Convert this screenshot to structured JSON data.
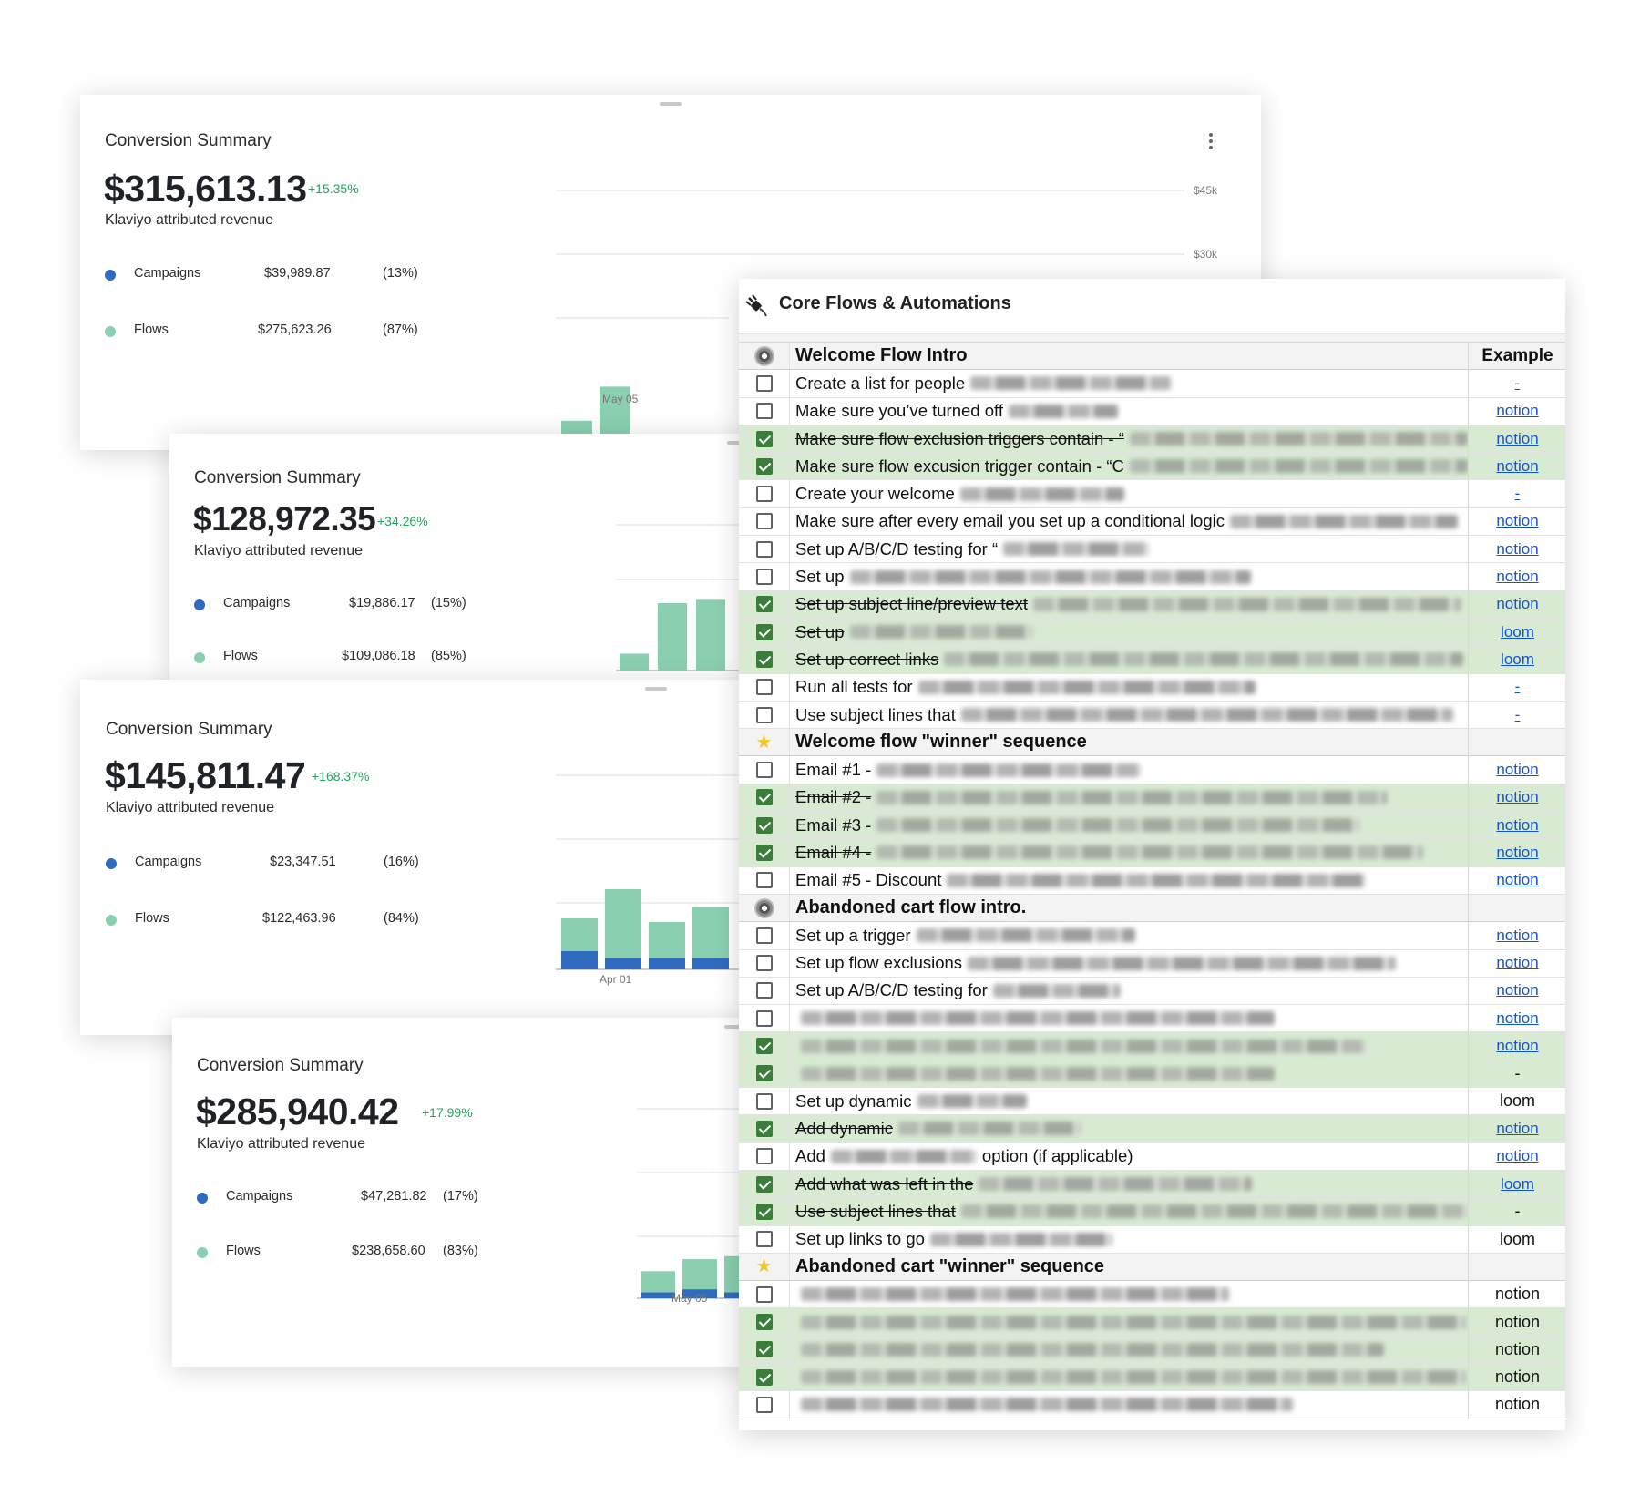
{
  "cards": [
    {
      "title": "Conversion Summary",
      "amount": "$315,613.13",
      "change": "+15.35%",
      "subtitle": "Klaviyo attributed revenue",
      "campaigns": {
        "label": "Campaigns",
        "value": "$39,989.87",
        "pct": "(13%)"
      },
      "flows": {
        "label": "Flows",
        "value": "$275,623.26",
        "pct": "(87%)"
      },
      "axis": {
        "top": "$45k",
        "mid": "$30k",
        "date": "May 05"
      }
    },
    {
      "title": "Conversion Summary",
      "amount": "$128,972.35",
      "change": "+34.26%",
      "subtitle": "Klaviyo attributed revenue",
      "campaigns": {
        "label": "Campaigns",
        "value": "$19,886.17",
        "pct": "(15%)"
      },
      "flows": {
        "label": "Flows",
        "value": "$109,086.18",
        "pct": "(85%)"
      }
    },
    {
      "title": "Conversion Summary",
      "amount": "$145,811.47",
      "change": "+168.37%",
      "subtitle": "Klaviyo attributed revenue",
      "campaigns": {
        "label": "Campaigns",
        "value": "$23,347.51",
        "pct": "(16%)"
      },
      "flows": {
        "label": "Flows",
        "value": "$122,463.96",
        "pct": "(84%)"
      },
      "axis": {
        "date": "Apr 01"
      }
    },
    {
      "title": "Conversion Summary",
      "amount": "$285,940.42",
      "change": "+17.99%",
      "subtitle": "Klaviyo attributed revenue",
      "campaigns": {
        "label": "Campaigns",
        "value": "$47,281.82",
        "pct": "(17%)"
      },
      "flows": {
        "label": "Flows",
        "value": "$238,658.60",
        "pct": "(83%)"
      },
      "axis": {
        "date": "May 05"
      }
    }
  ],
  "colors": {
    "campaigns": "#2f6bbf",
    "flows": "#8ad0b0",
    "done_row": "#d9ead3",
    "link": "#1155cc"
  },
  "chart_data": [
    {
      "type": "bar",
      "stacked": true,
      "series": [
        {
          "name": "Campaigns",
          "values": [
            2,
            4,
            0.5
          ]
        },
        {
          "name": "Flows",
          "values": [
            11,
            20,
            0.5
          ]
        }
      ]
    },
    {
      "type": "bar",
      "stacked": true,
      "series": [
        {
          "name": "Campaigns",
          "values": [
            0,
            0,
            0
          ]
        },
        {
          "name": "Flows",
          "values": [
            5,
            20,
            21
          ]
        }
      ]
    },
    {
      "type": "bar",
      "stacked": true,
      "series": [
        {
          "name": "Campaigns",
          "values": [
            5,
            3,
            3,
            3
          ]
        },
        {
          "name": "Flows",
          "values": [
            9,
            19,
            10,
            14
          ]
        }
      ]
    },
    {
      "type": "bar",
      "stacked": true,
      "series": [
        {
          "name": "Campaigns",
          "values": [
            2,
            3,
            2
          ]
        },
        {
          "name": "Flows",
          "values": [
            7,
            10,
            12
          ]
        }
      ]
    },
    {
      "type": "bar",
      "stacked": true,
      "series": [
        {
          "name": "Flows",
          "values": [
            5,
            15,
            28,
            17,
            28,
            29
          ]
        }
      ]
    }
  ],
  "sheet": {
    "title": "Core Flows & Automations",
    "rows": [
      {
        "kind": "section",
        "icon": "gear",
        "text": "Welcome Flow Intro",
        "ex": "Example"
      },
      {
        "kind": "item",
        "done": false,
        "text": "Create a list for people",
        "blur": 220,
        "ex": "-",
        "exStyle": "link"
      },
      {
        "kind": "item",
        "done": false,
        "text": "Make sure you’ve turned off",
        "blur": 120,
        "ex": "notion",
        "exStyle": "link"
      },
      {
        "kind": "item",
        "done": true,
        "text": "Make sure flow exclusion triggers contain - “",
        "blur": 380,
        "ex": "notion",
        "exStyle": "link"
      },
      {
        "kind": "item",
        "done": true,
        "text": "Make sure flow excusion trigger contain - “C",
        "blur": 390,
        "ex": "notion",
        "exStyle": "link"
      },
      {
        "kind": "item",
        "done": false,
        "text": "Create your welcome",
        "blur": 180,
        "ex": "-",
        "exStyle": "link"
      },
      {
        "kind": "item",
        "done": false,
        "text": "Make sure after every email you set up a conditional logic",
        "blur": 250,
        "ex": "notion",
        "exStyle": "link"
      },
      {
        "kind": "item",
        "done": false,
        "text": "Set up A/B/C/D testing for “",
        "blur": 160,
        "ex": "notion",
        "exStyle": "link"
      },
      {
        "kind": "item",
        "done": false,
        "text": "Set up",
        "blur": 440,
        "ex": "notion",
        "exStyle": "link"
      },
      {
        "kind": "item",
        "done": true,
        "text": "Set up subject line/preview text",
        "blur": 470,
        "ex": "notion",
        "exStyle": "link"
      },
      {
        "kind": "item",
        "done": true,
        "text": "Set up",
        "blur": 200,
        "ex": "loom",
        "exStyle": "link"
      },
      {
        "kind": "item",
        "done": true,
        "text": "Set up correct links",
        "blur": 570,
        "ex": "loom",
        "exStyle": "link"
      },
      {
        "kind": "item",
        "done": false,
        "text": "Run all tests for",
        "blur": 370,
        "ex": "-",
        "exStyle": "link"
      },
      {
        "kind": "item",
        "done": false,
        "text": "Use subject lines that",
        "blur": 540,
        "ex": "-",
        "exStyle": "link"
      },
      {
        "kind": "section",
        "icon": "star",
        "text": "Welcome flow \"winner\" sequence",
        "ex": ""
      },
      {
        "kind": "item",
        "done": false,
        "text": "Email #1 -",
        "blur": 290,
        "ex": "notion",
        "exStyle": "link"
      },
      {
        "kind": "item",
        "done": true,
        "text": "Email #2 -",
        "blur": 560,
        "ex": "notion",
        "exStyle": "plainlink"
      },
      {
        "kind": "item",
        "done": true,
        "text": "Email #3 -",
        "blur": 530,
        "ex": "notion",
        "exStyle": "plainlink"
      },
      {
        "kind": "item",
        "done": true,
        "text": "Email #4 -",
        "blur": 600,
        "ex": "notion",
        "exStyle": "plainlink"
      },
      {
        "kind": "item",
        "done": false,
        "text": "Email #5 - Discount",
        "blur": 460,
        "ex": "notion",
        "exStyle": "plainlink"
      },
      {
        "kind": "section",
        "icon": "gear",
        "text": "Abandoned cart flow intro.",
        "ex": ""
      },
      {
        "kind": "item",
        "done": false,
        "text": "Set up a trigger",
        "blur": 240,
        "ex": "notion",
        "exStyle": "plainlink"
      },
      {
        "kind": "item",
        "done": false,
        "text": "Set up flow exclusions",
        "blur": 470,
        "ex": "notion",
        "exStyle": "plainlink"
      },
      {
        "kind": "item",
        "done": false,
        "text": "Set up A/B/C/D testing for",
        "blur": 140,
        "ex": "notion",
        "exStyle": "plainlink"
      },
      {
        "kind": "item",
        "done": false,
        "text": "",
        "blur": 520,
        "ex": "notion",
        "exStyle": "plainlink"
      },
      {
        "kind": "item",
        "done": true,
        "text": "",
        "blur": 620,
        "ex": "notion",
        "exStyle": "plainlink"
      },
      {
        "kind": "item",
        "done": true,
        "text": "",
        "blur": 520,
        "ex": "-",
        "exStyle": "plain"
      },
      {
        "kind": "item",
        "done": false,
        "text": "Set up dynamic",
        "blur": 120,
        "ex": "loom",
        "exStyle": "plain"
      },
      {
        "kind": "item",
        "done": true,
        "text": "Add dynamic",
        "blur": 200,
        "ex": "notion",
        "exStyle": "plainlink"
      },
      {
        "kind": "item",
        "done": false,
        "text": "Add",
        "blur": 160,
        "tail": "option (if applicable)",
        "ex": "notion",
        "exStyle": "plainlink"
      },
      {
        "kind": "item",
        "done": true,
        "text": "Add what was left in the",
        "blur": 300,
        "ex": "loom",
        "exStyle": "plainlink"
      },
      {
        "kind": "item",
        "done": true,
        "text": "Use subject lines that",
        "blur": 560,
        "ex": "-",
        "exStyle": "plain"
      },
      {
        "kind": "item",
        "done": false,
        "text": "Set up links to go",
        "blur": 200,
        "ex": "loom",
        "exStyle": "plain"
      },
      {
        "kind": "section",
        "icon": "star",
        "text": "Abandoned cart \"winner\" sequence",
        "ex": ""
      },
      {
        "kind": "item",
        "done": false,
        "text": "",
        "blur": 470,
        "ex": "notion",
        "exStyle": "plain"
      },
      {
        "kind": "item",
        "done": true,
        "text": "",
        "blur": 730,
        "ex": "notion",
        "exStyle": "plain"
      },
      {
        "kind": "item",
        "done": true,
        "text": "",
        "blur": 640,
        "ex": "notion",
        "exStyle": "plain"
      },
      {
        "kind": "item",
        "done": true,
        "text": "",
        "blur": 730,
        "ex": "notion",
        "exStyle": "plain"
      },
      {
        "kind": "item",
        "done": false,
        "text": "",
        "blur": 540,
        "ex": "notion",
        "exStyle": "plain"
      }
    ]
  }
}
